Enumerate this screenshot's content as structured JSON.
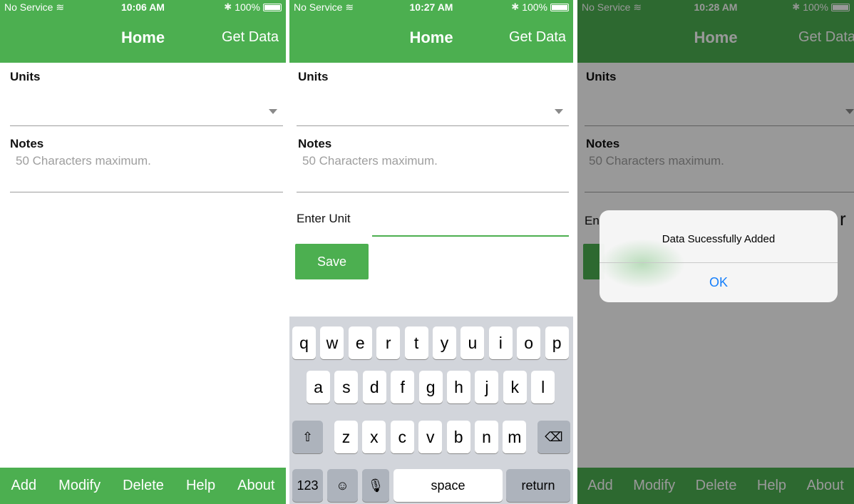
{
  "colors": {
    "brand": "#4caf50",
    "ios_blue": "#147efb",
    "keyboard_bg": "#d2d5db"
  },
  "screens": [
    {
      "status": {
        "carrier": "No Service",
        "time": "10:06 AM",
        "battery": "100%"
      },
      "nav": {
        "title": "Home",
        "right_button": "Get Data"
      },
      "units_label": "Units",
      "notes_label": "Notes",
      "notes_placeholder": "50 Characters maximum.",
      "tabs": [
        "Add",
        "Modify",
        "Delete",
        "Help",
        "About"
      ]
    },
    {
      "status": {
        "carrier": "No Service",
        "time": "10:27 AM",
        "battery": "100%"
      },
      "nav": {
        "title": "Home",
        "right_button": "Get Data"
      },
      "units_label": "Units",
      "notes_label": "Notes",
      "notes_placeholder": "50 Characters maximum.",
      "enter_unit_label": "Enter Unit",
      "save_label": "Save",
      "keyboard": {
        "row1": [
          "q",
          "w",
          "e",
          "r",
          "t",
          "y",
          "u",
          "i",
          "o",
          "p"
        ],
        "row2": [
          "a",
          "s",
          "d",
          "f",
          "g",
          "h",
          "j",
          "k",
          "l"
        ],
        "row3": [
          "z",
          "x",
          "c",
          "v",
          "b",
          "n",
          "m"
        ],
        "numbers": "123",
        "space": "space",
        "return": "return"
      }
    },
    {
      "status": {
        "carrier": "No Service",
        "time": "10:28 AM",
        "battery": "100%"
      },
      "nav": {
        "title": "Home",
        "right_button": "Get Data"
      },
      "units_label": "Units",
      "notes_label": "Notes",
      "notes_placeholder": "50 Characters maximum.",
      "enter_fragment": "En",
      "enter_fragment_right": "r",
      "alert": {
        "message": "Data Sucessfully Added",
        "ok": "OK"
      },
      "tabs": [
        "Add",
        "Modify",
        "Delete",
        "Help",
        "About"
      ]
    }
  ]
}
